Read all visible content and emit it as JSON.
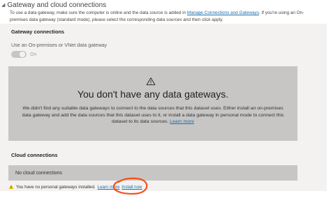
{
  "section": {
    "title": "Gateway and cloud connections"
  },
  "intro": {
    "text_before_link": "To use a data gateway, make sure the computer is online and the data source is added in ",
    "link_label": "Manage Connections and Gateways",
    "text_after_link": ". If you're using an On-premises data gateway (standard mode), please select the corresponding data sources and then click apply."
  },
  "gateway_connections": {
    "heading": "Gateway connections",
    "option_label": "Use an On-premises or VNet data gateway",
    "toggle_label": "On",
    "toggle_on": true,
    "empty_state": {
      "icon": "warning-icon",
      "title": "You don't have any data gateways.",
      "description": "We didn't find any suitable data gateways to connect to the data sources that this dataset uses. Either install an on-premises data gateway and add the data sources that this dataset uses to it, or install a data gateway in personal mode to connect this dataset to its data sources.",
      "learn_more": "Learn more"
    }
  },
  "cloud_connections": {
    "heading": "Cloud connections",
    "empty_text": "No cloud connections"
  },
  "footer": {
    "icon": "warning-icon",
    "message": "You have no personal gateways installed.",
    "learn_more": "Learn more",
    "install_now": "Install now"
  },
  "colors": {
    "panel_bg": "#f3f2f1",
    "empty_box_bg": "#c8c6c4",
    "link": "#1a6fb0",
    "warning_yellow": "#f2c811",
    "annotation_orange": "#f4511e"
  }
}
